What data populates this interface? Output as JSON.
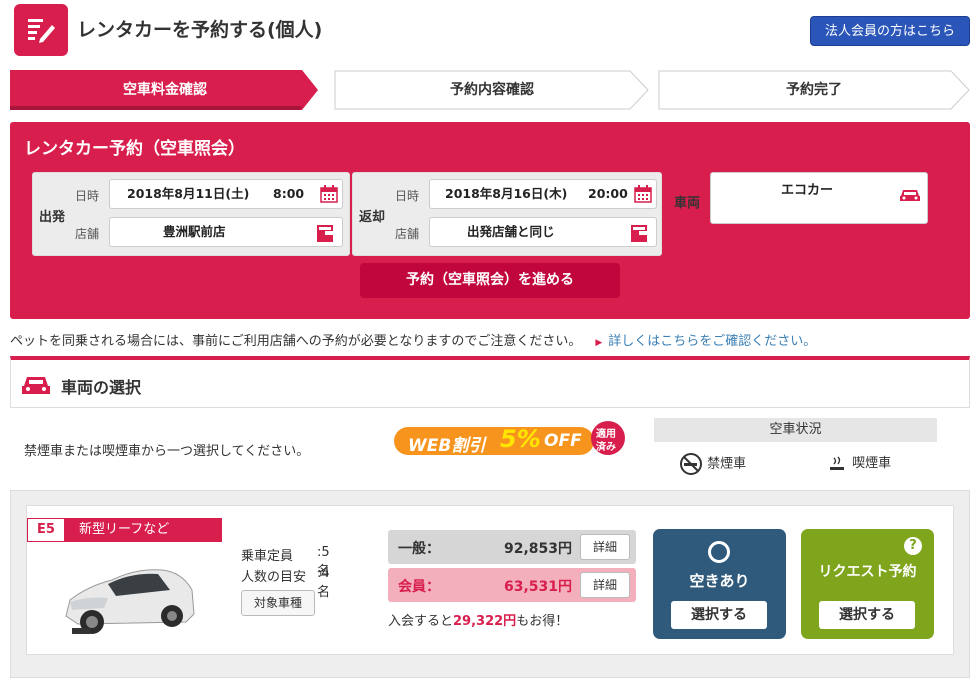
{
  "header": {
    "title": "レンタカーを予約する(個人)",
    "corporate_button": "法人会員の方はこちら"
  },
  "steps": [
    {
      "label": "空車料金確認",
      "active": true
    },
    {
      "label": "予約内容確認",
      "active": false
    },
    {
      "label": "予約完了",
      "active": false
    }
  ],
  "reservation": {
    "title": "レンタカー予約（空車照会）",
    "departure": {
      "label": "出発",
      "datetime_label": "日時",
      "date": "2018年8月11日(土)",
      "time": "8:00",
      "store_label": "店舗",
      "store": "豊洲駅前店"
    },
    "return": {
      "label": "返却",
      "datetime_label": "日時",
      "date": "2018年8月16日(木)",
      "time": "20:00",
      "store_label": "店舗",
      "store": "出発店舗と同じ"
    },
    "vehicle_label": "車両",
    "vehicle_value": "エコカー",
    "proceed_button": "予約（空車照会）を進める"
  },
  "notice": {
    "text": "ペットを同乗される場合には、事前にご利用店舗への予約が必要となりますのでご注意ください。",
    "link": "詳しくはこちらをご確認ください。"
  },
  "selection": {
    "title": "車両の選択",
    "instruction": "禁煙車または喫煙車から一つ選択してください。",
    "web_badge": {
      "main": "WEB割引",
      "pct": "5%",
      "off": "OFF",
      "applied": [
        "適用",
        "済み"
      ]
    },
    "status_header": "空車状況",
    "legend": {
      "nonsmoking": "禁煙車",
      "smoking": "喫煙車"
    }
  },
  "car": {
    "class": "E5",
    "model": "新型リーフなど",
    "capacity_label": "乗車定員",
    "capacity_value": ":5名",
    "guide_label": "人数の目安",
    "guide_value": ":4名",
    "target_button": "対象車種",
    "general_label": "一般：",
    "general_price": "92,853円",
    "member_label": "会員：",
    "member_price": "63,531円",
    "detail_button": "詳細",
    "save_prefix": "入会すると",
    "save_amount": "29,322円",
    "save_suffix": "もお得！",
    "available_label": "空きあり",
    "request_label": "リクエスト予約",
    "request_help": "?",
    "select_button": "選択する"
  },
  "colors": {
    "brand": "#d81e4d",
    "corporate": "#2b56b9",
    "available": "#2f5a7c",
    "request": "#7ea51c"
  }
}
